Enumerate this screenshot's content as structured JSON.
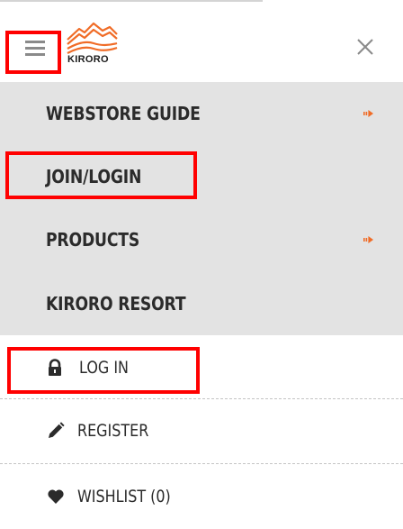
{
  "header": {
    "brand": "KIRORO",
    "menu_icon": "hamburger-menu-icon",
    "close_icon": "close-icon",
    "accent_color": "#f06c27"
  },
  "nav": {
    "items": [
      {
        "label": "WEBSTORE GUIDE",
        "has_submenu": true
      },
      {
        "label": "JOIN/LOGIN",
        "has_submenu": false
      },
      {
        "label": "PRODUCTS",
        "has_submenu": true
      },
      {
        "label": "KIRORO RESORT",
        "has_submenu": false
      }
    ]
  },
  "account": {
    "items": [
      {
        "label": "LOG IN",
        "icon": "lock-icon"
      },
      {
        "label": "REGISTER",
        "icon": "pencil-icon"
      },
      {
        "label": "WISHLIST (0)",
        "icon": "heart-icon"
      }
    ]
  },
  "colors": {
    "highlight": "#ff0000",
    "nav_background": "#e3e3e3",
    "text": "#2b2b2b"
  }
}
